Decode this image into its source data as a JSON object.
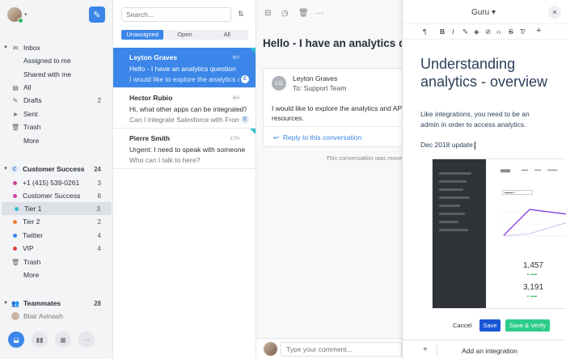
{
  "sidebar": {
    "items": [
      {
        "label": "Inbox",
        "count": ""
      },
      {
        "label": "Assigned to me",
        "count": ""
      },
      {
        "label": "Shared with me",
        "count": ""
      },
      {
        "label": "All",
        "count": ""
      },
      {
        "label": "Drafts",
        "count": "2"
      },
      {
        "label": "Sent",
        "count": ""
      },
      {
        "label": "Trash",
        "count": ""
      },
      {
        "label": "More",
        "count": ""
      }
    ],
    "team": {
      "badge": "C",
      "label": "Customer Success",
      "count": "24"
    },
    "team_items": [
      {
        "label": "+1 (415) 539-0261",
        "count": "3",
        "color": "#d23fa0"
      },
      {
        "label": "Customer Success",
        "count": "8",
        "color": "#d23fa0"
      },
      {
        "label": "Tier 1",
        "count": "3",
        "color": "#30c0d0"
      },
      {
        "label": "Tier 2",
        "count": "2",
        "color": "#f07f2e"
      },
      {
        "label": "Twitter",
        "count": "4",
        "color": "#3b86e8"
      },
      {
        "label": "VIP",
        "count": "4",
        "color": "#e0433c"
      },
      {
        "label": "Trash",
        "count": ""
      },
      {
        "label": "More",
        "count": ""
      }
    ],
    "teammates": {
      "label": "Teammates",
      "count": "28"
    },
    "teammate": "Blair Avinash"
  },
  "list": {
    "search_placeholder": "Search...",
    "tabs": [
      "Unassigned",
      "Open",
      "All"
    ],
    "conversations": [
      {
        "name": "Leyton Graves",
        "time": "6H",
        "subject": "Hello - I have an analytics question",
        "preview": "I would like to explore the analytics and",
        "badge": "C"
      },
      {
        "name": "Hector Rubio",
        "time": "6H",
        "subject": "Hi, what other apps can be integrated?",
        "preview": "Can I integrate Salesforce with Front?",
        "badge": "C"
      },
      {
        "name": "Pierre Smith",
        "time": "17H",
        "subject": "Urgent: I need to speak with someone",
        "preview": "Who can I talk to here?",
        "badge": ""
      }
    ]
  },
  "main": {
    "title": "Hello - I have an analytics question",
    "from_initials": "LG",
    "from": "Leyton Graves",
    "to": "To: Support Team",
    "body_line1": "I would like to explore the analytics and API",
    "body_line2": "resources.",
    "reply": "Reply to this conversation",
    "note": "This conversation was moved",
    "comment_placeholder": "Type your comment..."
  },
  "guru": {
    "name": "Guru",
    "title": "Understanding analytics - overview",
    "para1": "Like integrations, you need to be an admin in order to access analytics.",
    "para2": "Dec 2018 update:",
    "stat1": "1,457",
    "stat2": "3,191",
    "cancel": "Cancel",
    "save": "Save",
    "save_verify": "Save & Verify",
    "add_integration": "Add an integration"
  }
}
